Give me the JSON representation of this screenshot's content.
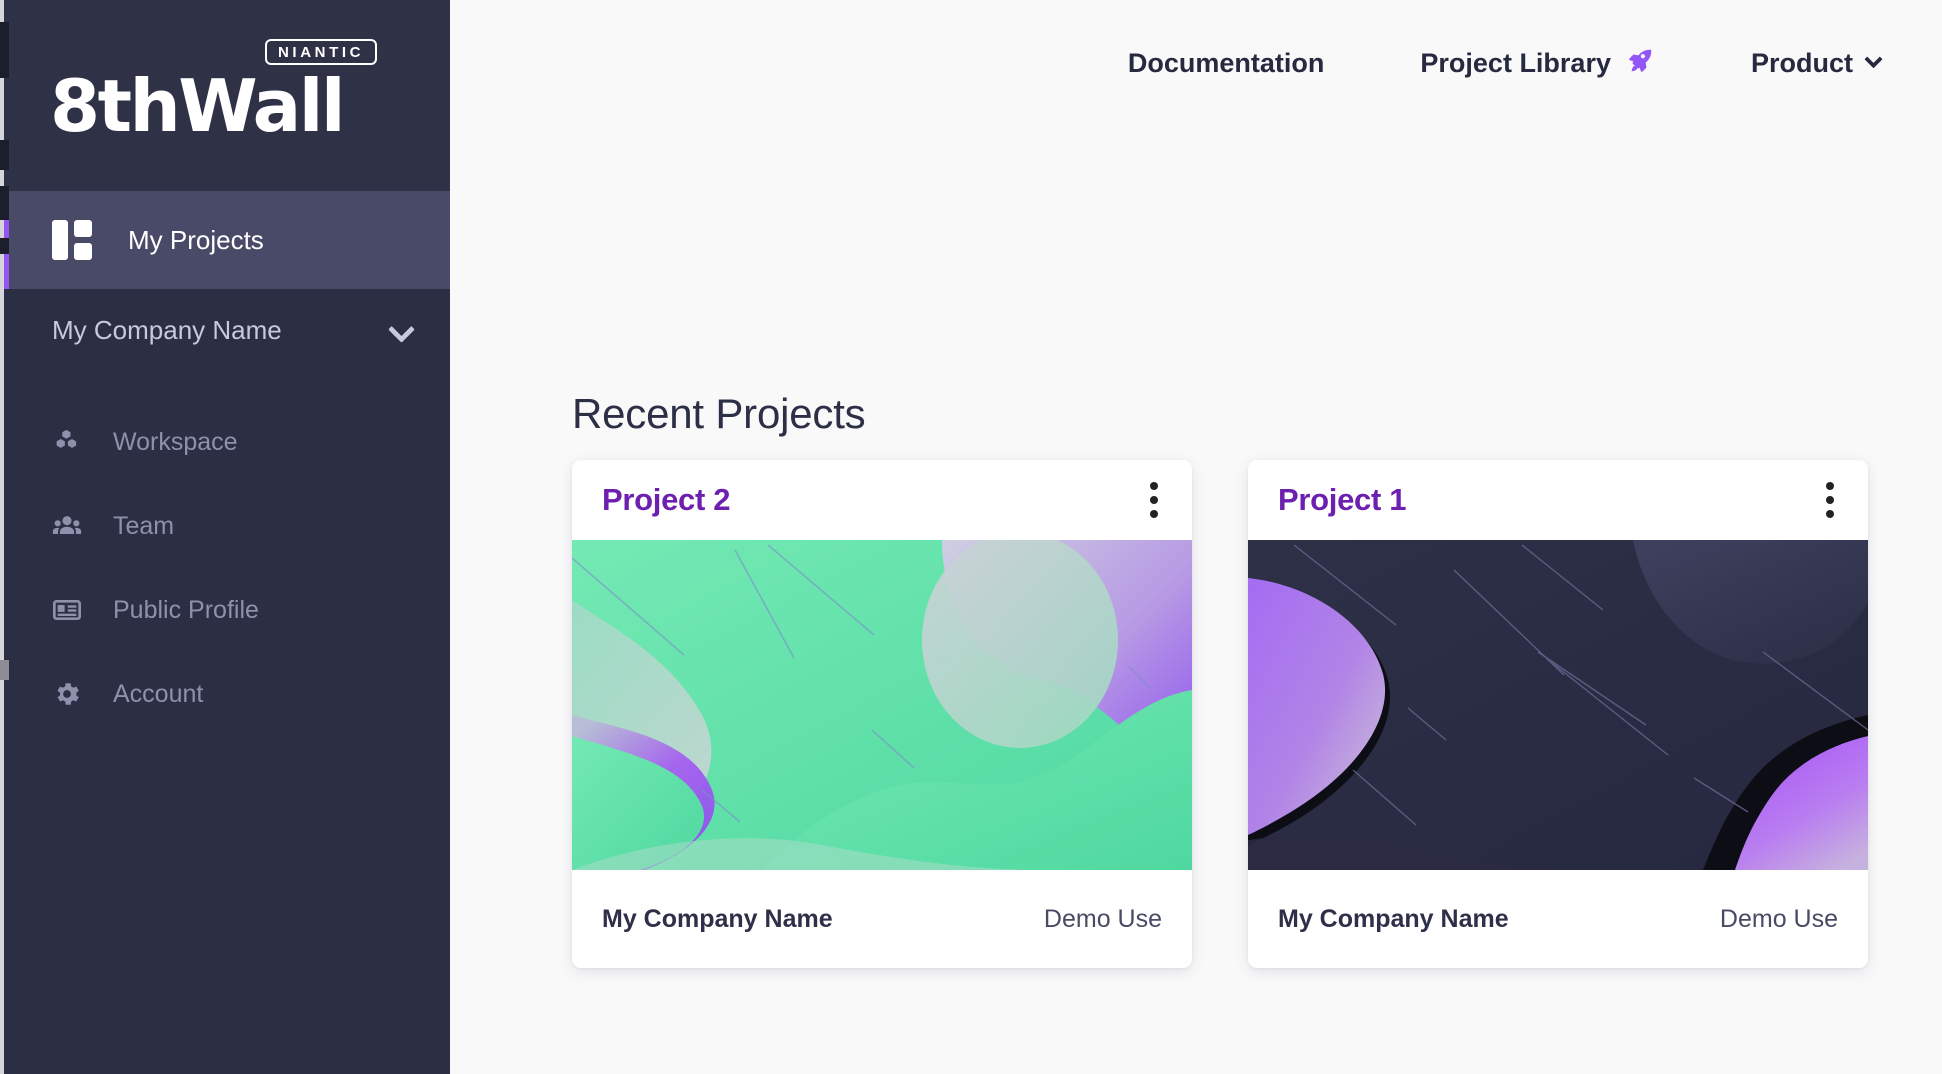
{
  "brand": {
    "badge": "NIANTIC",
    "name": "8thWall",
    "accent": "#9457f7",
    "title_purple": "#6d1fb0"
  },
  "sidebar": {
    "active_item": {
      "label": "My Projects",
      "icon": "grid-icon"
    },
    "company": {
      "label": "My Company Name",
      "icon": "chevron-down-icon"
    },
    "items": [
      {
        "label": "Workspace",
        "icon": "cubes-icon"
      },
      {
        "label": "Team",
        "icon": "people-icon"
      },
      {
        "label": "Public Profile",
        "icon": "profile-card-icon"
      },
      {
        "label": "Account",
        "icon": "gear-icon"
      }
    ]
  },
  "topnav": {
    "links": [
      {
        "label": "Documentation",
        "icon": null
      },
      {
        "label": "Project Library",
        "icon": "rocket-icon"
      },
      {
        "label": "Product",
        "icon": "chevron-down-icon"
      }
    ]
  },
  "main": {
    "heading": "Recent Projects",
    "cards": [
      {
        "title": "Project 2",
        "menu_icon": "kebab-menu-icon",
        "owner": "My Company Name",
        "plan": "Demo Use",
        "thumb_theme": "green"
      },
      {
        "title": "Project 1",
        "menu_icon": "kebab-menu-icon",
        "owner": "My Company Name",
        "plan": "Demo Use",
        "thumb_theme": "dark"
      }
    ]
  }
}
